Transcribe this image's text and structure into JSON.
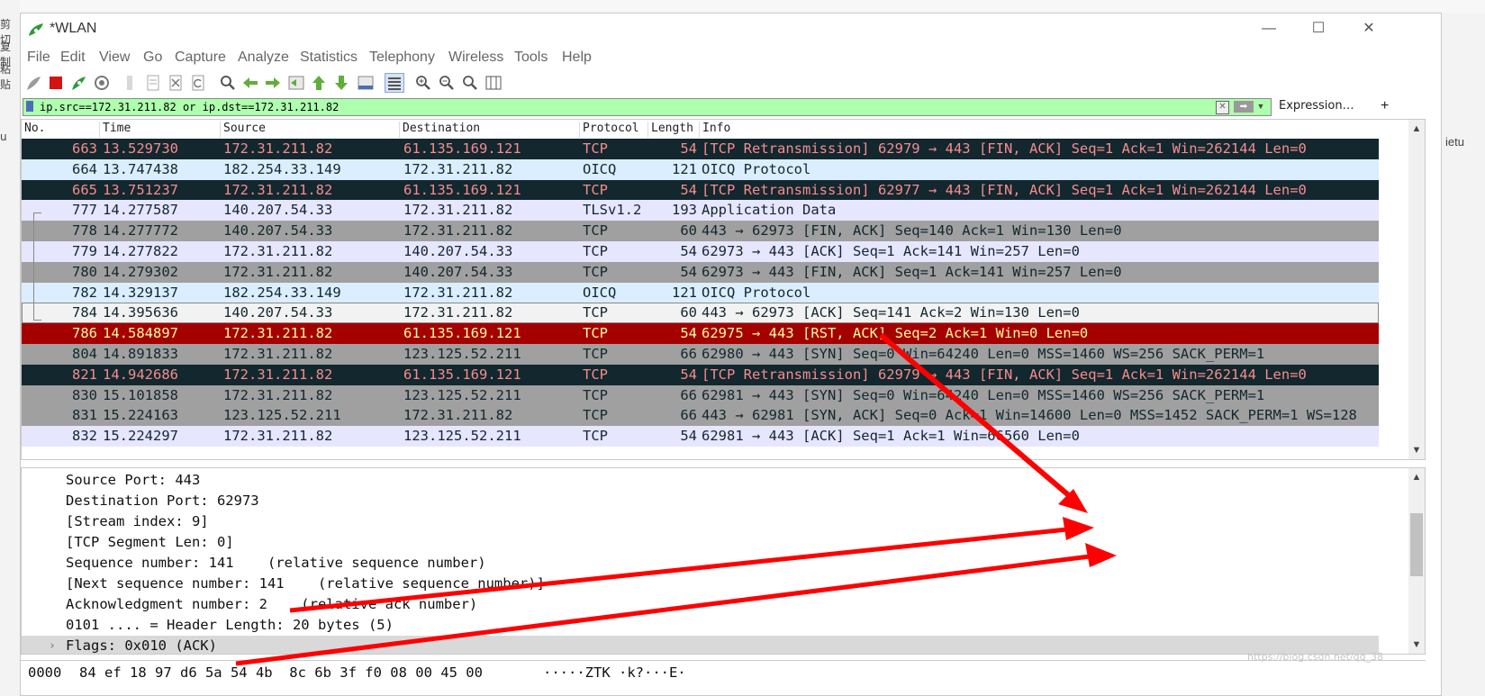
{
  "outer": {
    "left_texts": [
      "剪切",
      "复制",
      "粘贴",
      "u"
    ],
    "right_text": "ietu"
  },
  "window": {
    "title": "*WLAN",
    "minimize": "—",
    "maximize": "☐",
    "close": "✕"
  },
  "menu": [
    "File",
    "Edit",
    "View",
    "Go",
    "Capture",
    "Analyze",
    "Statistics",
    "Telephony",
    "Wireless",
    "Tools",
    "Help"
  ],
  "toolbar": [
    "shark-fin-icon",
    "stop-capture-icon",
    "restart-capture-icon",
    "capture-options-icon",
    "open-file-icon",
    "save-file-icon",
    "close-file-icon",
    "reload-file-icon",
    "find-packet-icon",
    "go-back-icon",
    "go-forward-icon",
    "go-to-packet-icon",
    "go-first-icon",
    "go-last-icon",
    "autoscroll-icon",
    "colorize-icon",
    "zoom-in-icon",
    "zoom-out-icon",
    "zoom-normal-icon",
    "resize-columns-icon"
  ],
  "filter": {
    "value": "ip.src==172.31.211.82 or ip.dst==172.31.211.82",
    "expression_label": "Expression…",
    "plus_label": "+"
  },
  "columns": [
    "No.",
    "Time",
    "Source",
    "Destination",
    "Protocol",
    "Length",
    "Info"
  ],
  "packets": [
    {
      "no": "663",
      "time": "13.529730",
      "src": "172.31.211.82",
      "dst": "61.135.169.121",
      "proto": "TCP",
      "len": "54",
      "info": "[TCP Retransmission] 62979 → 443 [FIN, ACK] Seq=1 Ack=1 Win=262144 Len=0",
      "bg": "#12272e",
      "fg": "#f78c8c"
    },
    {
      "no": "664",
      "time": "13.747438",
      "src": "182.254.33.149",
      "dst": "172.31.211.82",
      "proto": "OICQ",
      "len": "121",
      "info": "OICQ Protocol",
      "bg": "#daeeff",
      "fg": "#12272e"
    },
    {
      "no": "665",
      "time": "13.751237",
      "src": "172.31.211.82",
      "dst": "61.135.169.121",
      "proto": "TCP",
      "len": "54",
      "info": "[TCP Retransmission] 62977 → 443 [FIN, ACK] Seq=1 Ack=1 Win=262144 Len=0",
      "bg": "#12272e",
      "fg": "#f78c8c"
    },
    {
      "no": "777",
      "time": "14.277587",
      "src": "140.207.54.33",
      "dst": "172.31.211.82",
      "proto": "TLSv1.2",
      "len": "193",
      "info": "Application Data",
      "bg": "#e7e6ff",
      "fg": "#12272e"
    },
    {
      "no": "778",
      "time": "14.277772",
      "src": "140.207.54.33",
      "dst": "172.31.211.82",
      "proto": "TCP",
      "len": "60",
      "info": "443 → 62973 [FIN, ACK] Seq=140 Ack=1 Win=130 Len=0",
      "bg": "#a0a0a0",
      "fg": "#12272e"
    },
    {
      "no": "779",
      "time": "14.277822",
      "src": "172.31.211.82",
      "dst": "140.207.54.33",
      "proto": "TCP",
      "len": "54",
      "info": "62973 → 443 [ACK] Seq=1 Ack=141 Win=257 Len=0",
      "bg": "#e7e6ff",
      "fg": "#12272e"
    },
    {
      "no": "780",
      "time": "14.279302",
      "src": "172.31.211.82",
      "dst": "140.207.54.33",
      "proto": "TCP",
      "len": "54",
      "info": "62973 → 443 [FIN, ACK] Seq=1 Ack=141 Win=257 Len=0",
      "bg": "#a0a0a0",
      "fg": "#12272e"
    },
    {
      "no": "782",
      "time": "14.329137",
      "src": "182.254.33.149",
      "dst": "172.31.211.82",
      "proto": "OICQ",
      "len": "121",
      "info": "OICQ Protocol",
      "bg": "#daeeff",
      "fg": "#12272e"
    },
    {
      "no": "784",
      "time": "14.395636",
      "src": "140.207.54.33",
      "dst": "172.31.211.82",
      "proto": "TCP",
      "len": "60",
      "info": "443 → 62973 [ACK] Seq=141 Ack=2 Win=130 Len=0",
      "bg": "#f2f2f2",
      "fg": "#12272e",
      "selected": true
    },
    {
      "no": "786",
      "time": "14.584897",
      "src": "172.31.211.82",
      "dst": "61.135.169.121",
      "proto": "TCP",
      "len": "54",
      "info": "62975 → 443 [RST, ACK] Seq=2 Ack=1 Win=0 Len=0",
      "bg": "#a40000",
      "fg": "#fffc9c"
    },
    {
      "no": "804",
      "time": "14.891833",
      "src": "172.31.211.82",
      "dst": "123.125.52.211",
      "proto": "TCP",
      "len": "66",
      "info": "62980 → 443 [SYN] Seq=0 Win=64240 Len=0 MSS=1460 WS=256 SACK_PERM=1",
      "bg": "#a0a0a0",
      "fg": "#12272e"
    },
    {
      "no": "821",
      "time": "14.942686",
      "src": "172.31.211.82",
      "dst": "61.135.169.121",
      "proto": "TCP",
      "len": "54",
      "info": "[TCP Retransmission] 62979 → 443 [FIN, ACK] Seq=1 Ack=1 Win=262144 Len=0",
      "bg": "#12272e",
      "fg": "#f78c8c"
    },
    {
      "no": "830",
      "time": "15.101858",
      "src": "172.31.211.82",
      "dst": "123.125.52.211",
      "proto": "TCP",
      "len": "66",
      "info": "62981 → 443 [SYN] Seq=0 Win=64240 Len=0 MSS=1460 WS=256 SACK_PERM=1",
      "bg": "#a0a0a0",
      "fg": "#12272e"
    },
    {
      "no": "831",
      "time": "15.224163",
      "src": "123.125.52.211",
      "dst": "172.31.211.82",
      "proto": "TCP",
      "len": "66",
      "info": "443 → 62981 [SYN, ACK] Seq=0 Ack=1 Win=14600 Len=0 MSS=1452 SACK_PERM=1 WS=128",
      "bg": "#a0a0a0",
      "fg": "#12272e"
    },
    {
      "no": "832",
      "time": "15.224297",
      "src": "172.31.211.82",
      "dst": "123.125.52.211",
      "proto": "TCP",
      "len": "54",
      "info": "62981 → 443 [ACK] Seq=1 Ack=1 Win=66560 Len=0",
      "bg": "#e7e6ff",
      "fg": "#12272e"
    }
  ],
  "details": [
    {
      "text": "Source Port: 443"
    },
    {
      "text": "Destination Port: 62973"
    },
    {
      "text": "[Stream index: 9]"
    },
    {
      "text": "[TCP Segment Len: 0]"
    },
    {
      "text": "Sequence number: 141    (relative sequence number)"
    },
    {
      "text": "[Next sequence number: 141    (relative sequence number)]"
    },
    {
      "text": "Acknowledgment number: 2    (relative ack number)"
    },
    {
      "text": "0101 .... = Header Length: 20 bytes (5)"
    },
    {
      "text": "Flags: 0x010 (ACK)",
      "expandable": true,
      "expander": "›"
    }
  ],
  "hex": {
    "offset": "0000",
    "bytes": "84 ef 18 97 d6 5a 54 4b  8c 6b 3f f0 08 00 45 00",
    "ascii": "·····ZTK ·k?···E·"
  },
  "watermark": "https://blog.csdn.net/qq_38"
}
